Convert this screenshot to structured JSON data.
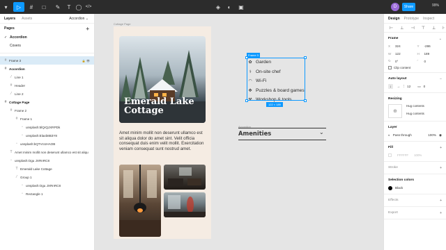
{
  "toolbar": {
    "tools": [
      "▾",
      "▷",
      "#",
      "□",
      "✎",
      "T",
      "◯",
      "</>"
    ],
    "center_icons": [
      "◈",
      "◐",
      "▣"
    ],
    "avatar": "D",
    "share_label": "Share",
    "zoom": "99%"
  },
  "left_panel": {
    "tabs": [
      "Layers",
      "Assets"
    ],
    "page_selector": "Accordion ⌄",
    "pages_heading": "Pages",
    "pages": [
      {
        "label": "Accordion",
        "current": true
      },
      {
        "label": "Covers",
        "current": false
      }
    ],
    "layers": [
      {
        "label": "Frame 3",
        "icon": "#",
        "indent": 0,
        "selected": true,
        "bold": false,
        "tail": "🔒 👁"
      },
      {
        "label": "Accordion",
        "icon": "#",
        "indent": 0,
        "selected": false,
        "bold": true,
        "tail": ""
      },
      {
        "label": "Line 1",
        "icon": "⁄",
        "indent": 1,
        "selected": false,
        "bold": false,
        "tail": ""
      },
      {
        "label": "Header",
        "icon": "#",
        "indent": 1,
        "selected": false,
        "bold": false,
        "tail": ""
      },
      {
        "label": "Line 2",
        "icon": "⁄",
        "indent": 1,
        "selected": false,
        "bold": false,
        "tail": ""
      },
      {
        "label": "Cottage Page",
        "icon": "#",
        "indent": 0,
        "selected": false,
        "bold": true,
        "tail": ""
      },
      {
        "label": "Frame 2",
        "icon": "#",
        "indent": 1,
        "selected": false,
        "bold": false,
        "tail": ""
      },
      {
        "label": "Frame 1",
        "icon": "#",
        "indent": 2,
        "selected": false,
        "bold": false,
        "tail": ""
      },
      {
        "label": "unsplash:5lQrQJXRPDk",
        "icon": "▫",
        "indent": 3,
        "selected": false,
        "bold": false,
        "tail": ""
      },
      {
        "label": "unsplash:Elaxb8B3Y8",
        "icon": "▫",
        "indent": 3,
        "selected": false,
        "bold": false,
        "tail": ""
      },
      {
        "label": "unsplash:bQTVcUHAOB",
        "icon": "▫",
        "indent": 2,
        "selected": false,
        "bold": false,
        "tail": ""
      },
      {
        "label": "Amet minim mollit non deserunt ullamco est sit aliqu",
        "icon": "T",
        "indent": 1,
        "selected": false,
        "bold": false,
        "tail": ""
      },
      {
        "label": "unsplash:Ogu JXRnRC8",
        "icon": "▫",
        "indent": 1,
        "selected": false,
        "bold": false,
        "tail": ""
      },
      {
        "label": "Emerald Lake Cottage",
        "icon": "T",
        "indent": 2,
        "selected": false,
        "bold": false,
        "tail": ""
      },
      {
        "label": "Group 1",
        "icon": "⁄",
        "indent": 2,
        "selected": false,
        "bold": false,
        "tail": ""
      },
      {
        "label": "unsplash:Ogu JXRnRC8",
        "icon": "▫",
        "indent": 3,
        "selected": false,
        "bold": false,
        "tail": ""
      },
      {
        "label": "Rectangle 1",
        "icon": "▫",
        "indent": 3,
        "selected": false,
        "bold": false,
        "tail": ""
      }
    ]
  },
  "canvas": {
    "frame_label": "Cottage Page",
    "hero_title": "Emerald Lake Cottage",
    "body_text": "Amet minim mollit non deserunt ullamco est sit aliqua dolor do amet sint. Velit officia consequat duis enim velit mollit. Exercitation veniam consequat sunt nostrud amet.",
    "selection_name": "Frame 3",
    "selection_size": "122 × 189",
    "amenities": [
      {
        "icon": "✿",
        "label": "Garden"
      },
      {
        "icon": "⚕",
        "label": "On-site chef"
      },
      {
        "icon": "◠",
        "label": "Wi-Fi"
      },
      {
        "icon": "✥",
        "label": "Puzzles & board games"
      },
      {
        "icon": "⚒",
        "label": "Workshop & tools"
      }
    ],
    "accordion_label": "Accordion",
    "accordion_title": "Amenities",
    "accordion_chevron": "⌄",
    "help_label": "?"
  },
  "right_panel": {
    "tabs": [
      "Design",
      "Prototype",
      "Inspect"
    ],
    "align_icons": [
      "⊢",
      "⊥",
      "⊣",
      "⊤",
      "⊥",
      "⊦"
    ],
    "frame": {
      "heading": "Frame",
      "fields": [
        {
          "k": "X",
          "v": "324"
        },
        {
          "k": "Y",
          "v": "-286"
        },
        {
          "k": "W",
          "v": "122"
        },
        {
          "k": "H",
          "v": "189"
        },
        {
          "k": "↻",
          "v": "0°"
        },
        {
          "k": "◜",
          "v": "0"
        }
      ],
      "clip_label": "Clip content"
    },
    "auto_layout": {
      "heading": "Auto layout",
      "gap": "12",
      "padding": "0"
    },
    "resizing": {
      "heading": "Resizing",
      "options": [
        "Hug contents",
        "Hug contents"
      ]
    },
    "layer": {
      "heading": "Layer",
      "blend": "Pass through",
      "opacity": "100%"
    },
    "fill": {
      "heading": "Fill",
      "hex": "FFFFFF",
      "opacity": "100%"
    },
    "stroke": {
      "heading": "Stroke"
    },
    "selection_colors": {
      "heading": "Selection colors",
      "color_name": "Black",
      "color_hex": "#000000"
    },
    "effects": {
      "heading": "Effects"
    },
    "export": {
      "heading": "Export"
    }
  }
}
